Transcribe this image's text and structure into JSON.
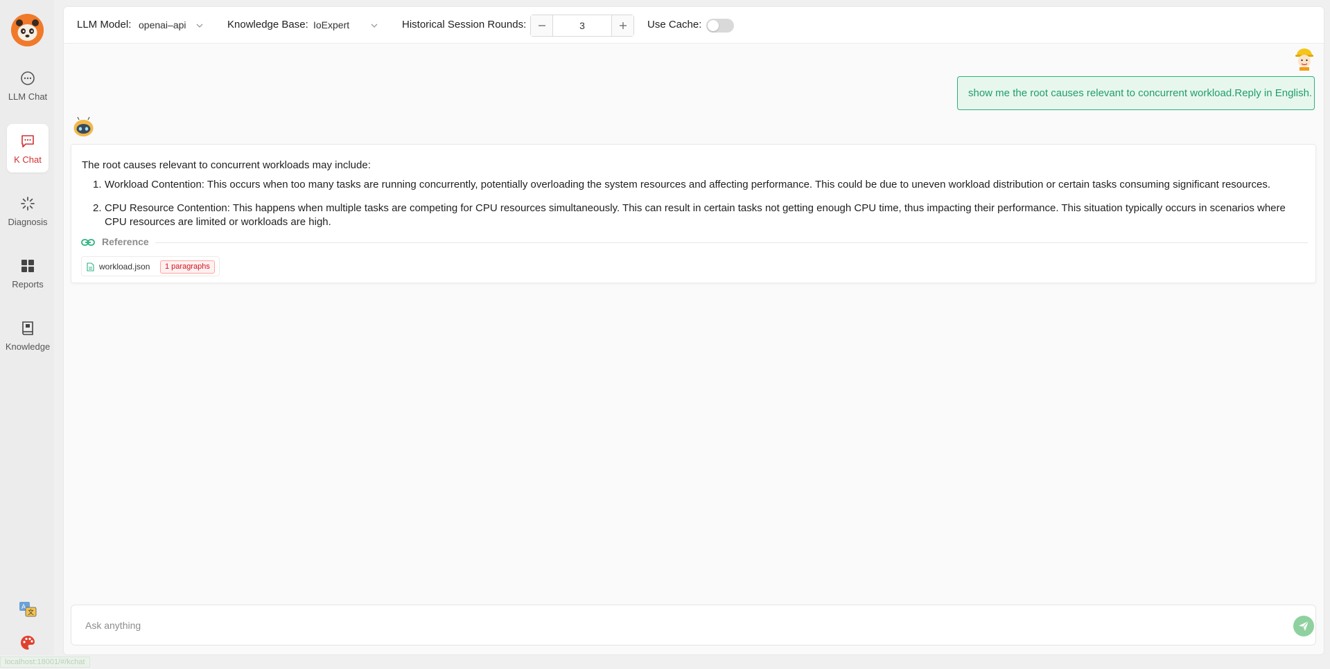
{
  "sidebar": {
    "items": [
      {
        "label": "LLM Chat",
        "icon": "chat-bubble-icon"
      },
      {
        "label": "K Chat",
        "icon": "message-square-icon",
        "active": true
      },
      {
        "label": "Diagnosis",
        "icon": "loading-spinner-icon"
      },
      {
        "label": "Reports",
        "icon": "grid-icon"
      },
      {
        "label": "Knowledge",
        "icon": "book-icon"
      }
    ],
    "bottom_icons": [
      "translate-icon",
      "palette-icon"
    ]
  },
  "toolbar": {
    "llm_model_label": "LLM Model:",
    "llm_model_value": "openai–api",
    "knowledge_base_label": "Knowledge Base:",
    "knowledge_base_value": "IoExpert",
    "history_rounds_label": "Historical Session Rounds:",
    "history_rounds_value": "3",
    "use_cache_label": "Use Cache:",
    "use_cache_on": false
  },
  "chat": {
    "user_message": "show me the root causes relevant to concurrent workload.Reply in English.",
    "bot_intro": "The root causes relevant to concurrent workloads may include:",
    "bot_items": [
      {
        "num": "1.",
        "text": "Workload Contention: This occurs when too many tasks are running concurrently, potentially overloading the system resources and affecting performance. This could be due to uneven workload distribution or certain tasks consuming significant resources."
      },
      {
        "num": "2.",
        "text": "CPU Resource Contention: This happens when multiple tasks are competing for CPU resources simultaneously. This can result in certain tasks not getting enough CPU time, thus impacting their performance. This situation typically occurs in scenarios where CPU resources are limited or workloads are high."
      }
    ],
    "reference_label": "Reference",
    "reference_file": "workload.json",
    "reference_paragraphs": "1 paragraphs"
  },
  "input": {
    "placeholder": "Ask anything"
  },
  "status": {
    "text": "localhost:18001/#/kchat"
  },
  "colors": {
    "accent_green": "#2bb07f",
    "active_red": "#d03030",
    "send_green": "#8fd19e"
  }
}
